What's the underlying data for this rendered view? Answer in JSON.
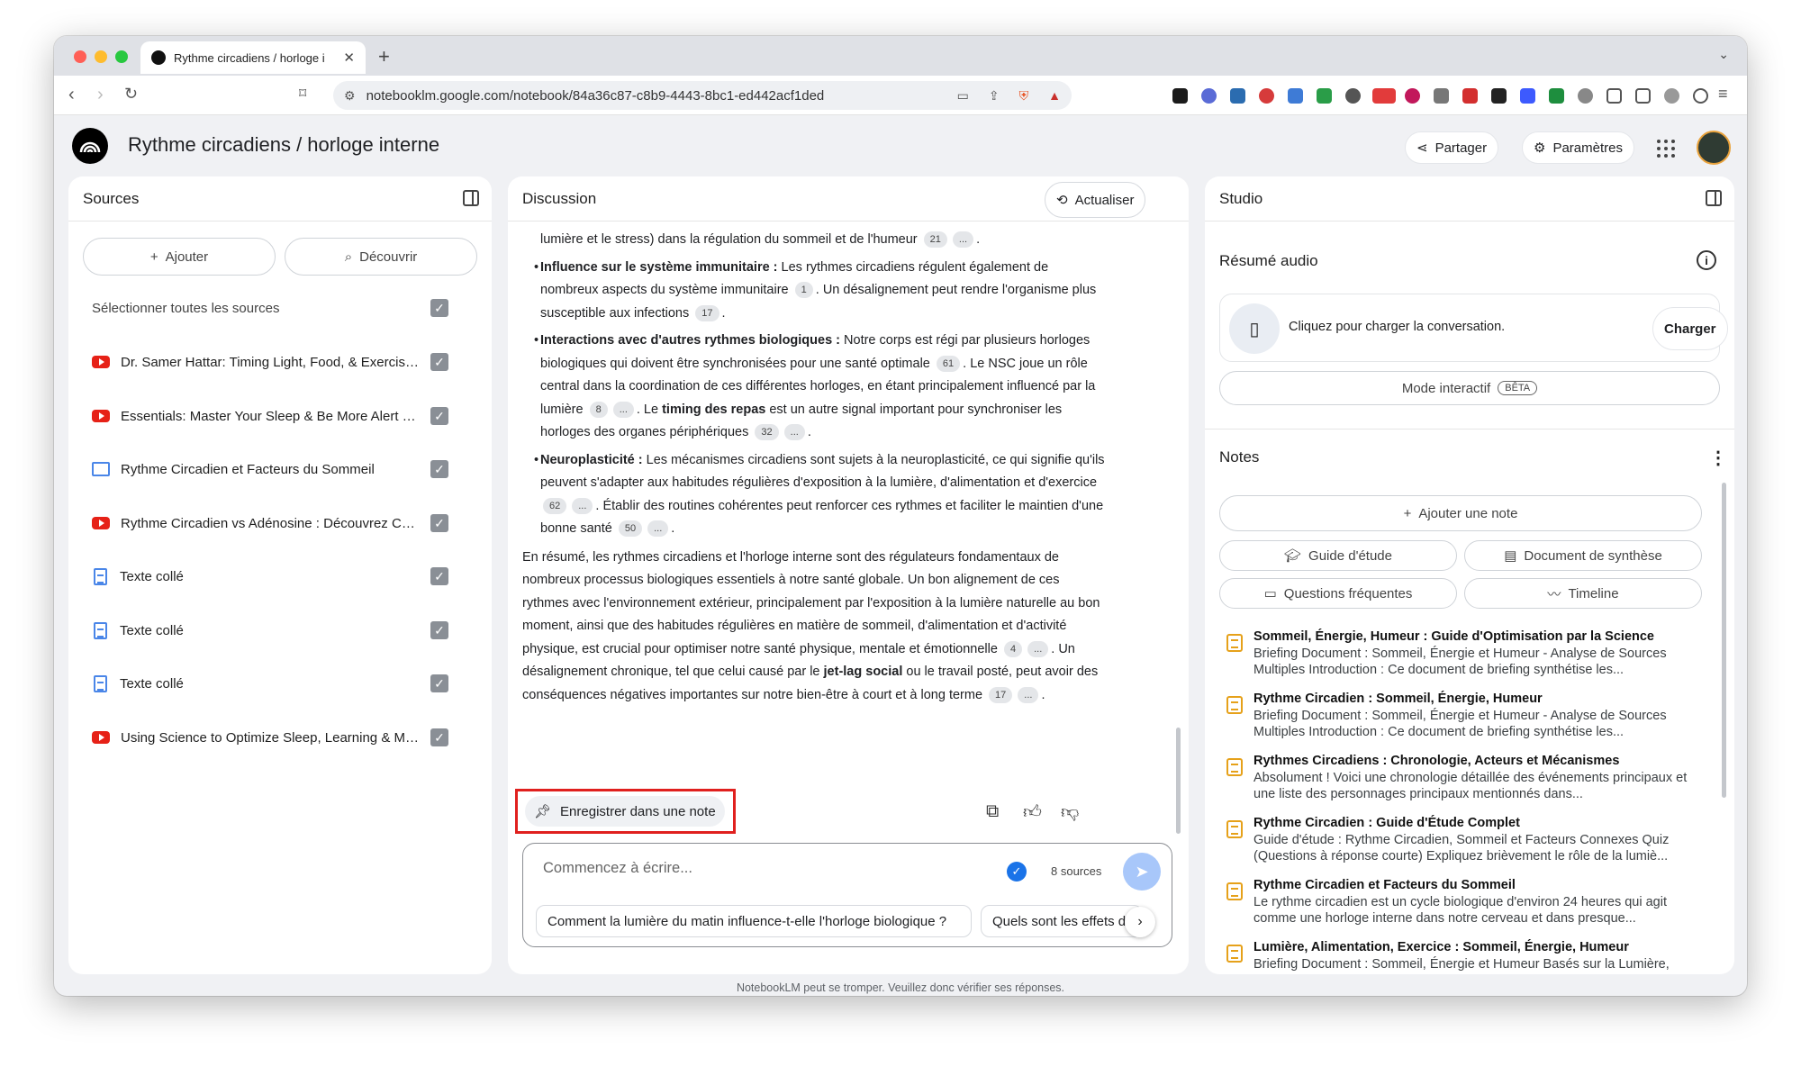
{
  "browser": {
    "tab_title": "Rythme circadiens / horloge i",
    "url": "notebooklm.google.com/notebook/84a36c87-c8b9-4443-8bc1-ed442acf1ded"
  },
  "app": {
    "title": "Rythme circadiens / horloge interne",
    "share_label": "Partager",
    "settings_label": "Paramètres",
    "footer": "NotebookLM peut se tromper. Veuillez donc vérifier ses réponses."
  },
  "sources": {
    "title": "Sources",
    "add_label": "Ajouter",
    "discover_label": "Découvrir",
    "select_all": "Sélectionner toutes les sources",
    "items": [
      {
        "type": "youtube",
        "label": "Dr. Samer Hattar: Timing Light, Food, & Exercise fo..."
      },
      {
        "type": "youtube",
        "label": "Essentials: Master Your Sleep & Be More Alert Wh..."
      },
      {
        "type": "web",
        "label": "Rythme Circadien et Facteurs du Sommeil"
      },
      {
        "type": "youtube",
        "label": "Rythme Circadien vs Adénosine : Découvrez Com..."
      },
      {
        "type": "text",
        "label": "Texte collé"
      },
      {
        "type": "text",
        "label": "Texte collé"
      },
      {
        "type": "text",
        "label": "Texte collé"
      },
      {
        "type": "youtube",
        "label": "Using Science to Optimize Sleep, Learning & Meta..."
      }
    ]
  },
  "discussion": {
    "title": "Discussion",
    "refresh_label": "Actualiser",
    "frag_top": "lumière et le stress) dans la régulation du sommeil et de l'humeur",
    "c21": "21",
    "more": "...",
    "b1_title": "Influence sur le système immunitaire :",
    "b1_t1": " Les rythmes circadiens régulent également de nombreux aspects du système immunitaire",
    "c1": "1",
    "b1_t2": ". Un désalignement peut rendre l'organisme plus susceptible aux infections",
    "c17": "17",
    "b2_title": "Interactions avec d'autres rythmes biologiques :",
    "b2_t1": " Notre corps est régi par plusieurs horloges biologiques qui doivent être synchronisées pour une santé optimale",
    "c61": "61",
    "b2_t2": ". Le NSC joue un rôle central dans la coordination de ces différentes horloges, en étant principalement influencé par la lumière",
    "c8": "8",
    "b2_t3": ". Le ",
    "b2_bold": "timing des repas",
    "b2_t4": " est un autre signal important pour synchroniser les horloges des organes périphériques",
    "c32": "32",
    "b3_title": "Neuroplasticité :",
    "b3_t1": " Les mécanismes circadiens sont sujets à la neuroplasticité, ce qui signifie qu'ils peuvent s'adapter aux habitudes régulières d'exposition à la lumière, d'alimentation et d'exercice",
    "c62": "62",
    "b3_t2": ". Établir des routines cohérentes peut renforcer ces rythmes et faciliter le maintien d'une bonne santé",
    "c50": "50",
    "sum_t1": "En résumé, les rythmes circadiens et l'horloge interne sont des régulateurs fondamentaux de nombreux processus biologiques essentiels à notre santé globale. Un bon alignement de ces rythmes avec l'environnement extérieur, principalement par l'exposition à la lumière naturelle au bon moment, ainsi que des habitudes régulières en matière de sommeil, d'alimentation et d'activité physique, est crucial pour optimiser notre santé physique, mentale et émotionnelle",
    "c4": "4",
    "sum_t2": ". Un désalignement chronique, tel que celui causé par le ",
    "sum_bold": "jet-lag social",
    "sum_t3": " ou le travail posté, peut avoir des conséquences négatives importantes sur notre bien-être à court et à long terme",
    "c17b": "17",
    "save_note": "Enregistrer dans une note",
    "input_placeholder": "Commencez à écrire...",
    "sources_count": "8 sources",
    "suggestions": [
      "Comment la lumière du matin influence-t-elle l'horloge biologique ?",
      "Quels sont les effets d"
    ]
  },
  "studio": {
    "title": "Studio",
    "audio_title": "Résumé audio",
    "audio_prompt": "Cliquez pour charger la conversation.",
    "load_label": "Charger",
    "interactive_label": "Mode interactif",
    "beta": "BÊTA",
    "notes_title": "Notes",
    "add_note": "Ajouter une note",
    "study_guide": "Guide d'étude",
    "synthesis_doc": "Document de synthèse",
    "faq": "Questions fréquentes",
    "timeline": "Timeline",
    "notes": [
      {
        "title": "Sommeil, Énergie, Humeur : Guide d'Optimisation par la Science",
        "body": "Briefing Document : Sommeil, Énergie et Humeur - Analyse de Sources Multiples Introduction : Ce document de briefing synthétise les..."
      },
      {
        "title": "Rythme Circadien : Sommeil, Énergie, Humeur",
        "body": "Briefing Document : Sommeil, Énergie et Humeur - Analyse de Sources Multiples Introduction : Ce document de briefing synthétise les..."
      },
      {
        "title": "Rythmes Circadiens : Chronologie, Acteurs et Mécanismes",
        "body": "Absolument ! Voici une chronologie détaillée des événements principaux et une liste des personnages principaux mentionnés dans..."
      },
      {
        "title": "Rythme Circadien : Guide d'Étude Complet",
        "body": "Guide d'étude : Rythme Circadien, Sommeil et Facteurs Connexes Quiz (Questions à réponse courte) Expliquez brièvement le rôle de la lumiè..."
      },
      {
        "title": "Rythme Circadien et Facteurs du Sommeil",
        "body": "Le rythme circadien est un cycle biologique d'environ 24 heures qui agit comme une horloge interne dans notre cerveau et dans presque..."
      },
      {
        "title": "Lumière, Alimentation, Exercice : Sommeil, Énergie, Humeur",
        "body": "Briefing Document : Sommeil, Énergie et Humeur Basés sur la Lumière, l'Alimentation et l'Exercice Ce rapport Examine le \"Dr. Samer Hattar\"..."
      }
    ]
  },
  "colors": {
    "accent_red": "#e0201e",
    "link_blue": "#1a73e8",
    "note_orange": "#e6a11a",
    "youtube_red": "#e62117"
  }
}
